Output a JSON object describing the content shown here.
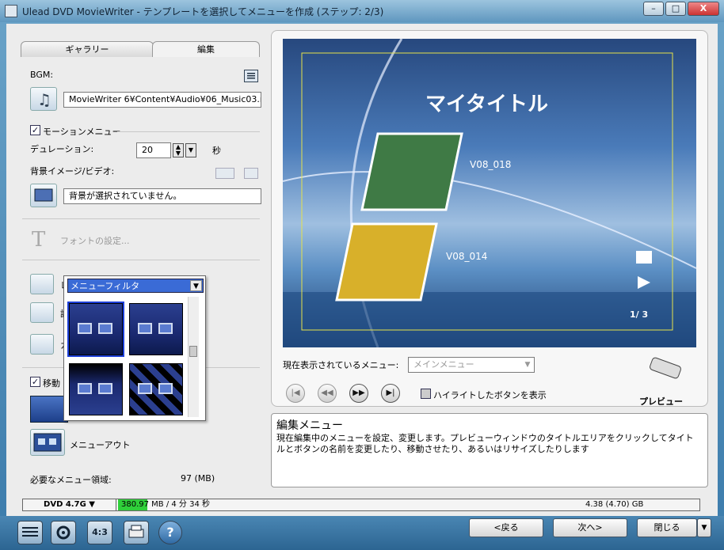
{
  "window": {
    "title": "Ulead DVD MovieWriter - テンプレートを選択してメニューを作成 (ステップ: 2/3)",
    "minimize": "–",
    "maximize": "□",
    "close": "X"
  },
  "tabs": [
    {
      "label": "ギャラリー"
    },
    {
      "label": "編集"
    }
  ],
  "bgm": {
    "label": "BGM:",
    "path": "MovieWriter 6¥Content¥Audio¥06_Music03.mpa"
  },
  "motion_menu": {
    "label": "モーションメニュー",
    "checked": true,
    "duration_label": "デュレーション:",
    "duration_value": "20",
    "duration_unit": "秒"
  },
  "background": {
    "label": "背景イメージ/ビデオ:",
    "value": "背景が選択されていません。"
  },
  "font_settings": {
    "label": "フォントの設定..."
  },
  "partial_labels": {
    "layout": "レ",
    "detail": "詳",
    "custom": "カ",
    "moving": "移動"
  },
  "menu_filter": {
    "selected": "メニューフィルタ"
  },
  "menu_out": {
    "label": "メニューアウト"
  },
  "required_space": {
    "label": "必要なメニュー領域:",
    "value": "97 (MB)"
  },
  "preview": {
    "menu_title": "マイタイトル",
    "items": [
      {
        "label": "V08_018"
      },
      {
        "label": "V08_014"
      }
    ],
    "page": "1/ 3",
    "current_menu_label": "現在表示されているメニュー:",
    "current_menu_value": "メインメニュー",
    "highlight_label": "ハイライトしたボタンを表示",
    "preview_label": "プレビュー"
  },
  "help": {
    "title": "編集メニュー",
    "text": "現在編集中のメニューを設定、変更します。プレビューウィンドウのタイトルエリアをクリックしてタイトルとボタンの名前を変更したり、移動させたり、あるいはリサイズしたりします"
  },
  "status": {
    "disc": "DVD 4.7G",
    "used": "380.97 MB / 4 分 34 秒",
    "capacity": "4.38 (4.70) GB",
    "used_fraction": 0.005
  },
  "nav": {
    "back": "<戻る",
    "next": "次へ>",
    "close": "閉じる"
  },
  "bottom_icons": {
    "aspect": "4:3"
  }
}
